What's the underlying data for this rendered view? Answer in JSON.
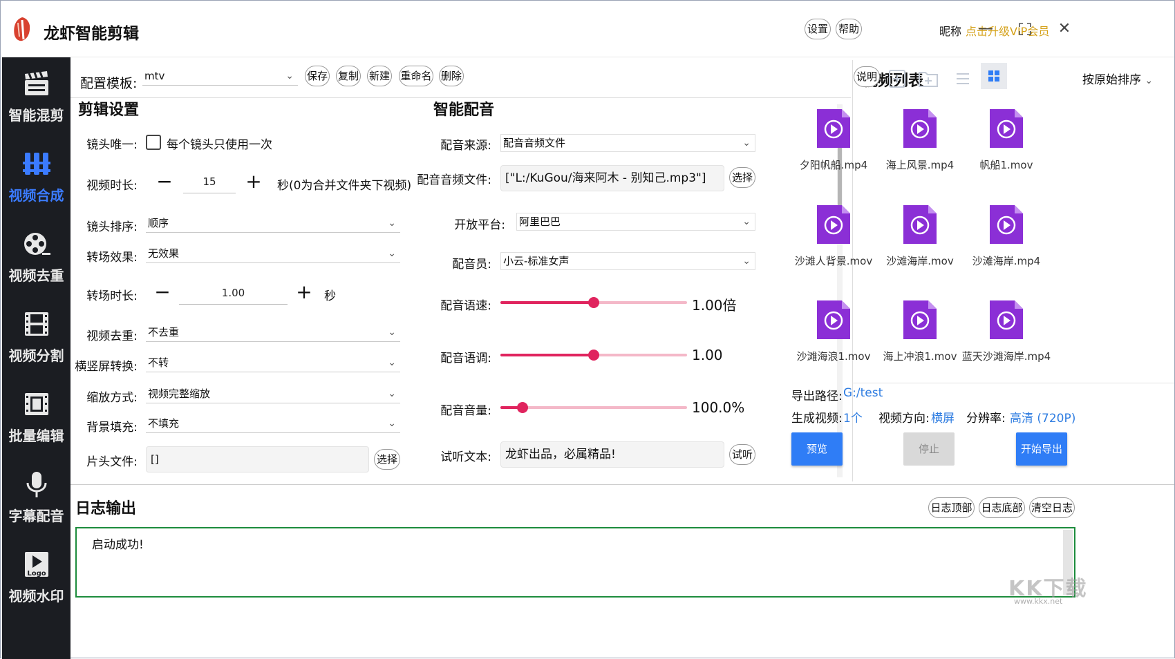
{
  "app": {
    "title": "龙虾智能剪辑"
  },
  "header": {
    "settings_label": "设置",
    "help_label": "帮助",
    "nickname_label": "昵称",
    "vip_label": "点击升级VIP会员",
    "minimize": "—",
    "maximize": "⛶",
    "close": "✕"
  },
  "sidebar": {
    "items": [
      {
        "label": "智能混剪",
        "icon": "clapperboard-icon"
      },
      {
        "label": "视频合成",
        "icon": "film-strips-icon",
        "active": true
      },
      {
        "label": "视频去重",
        "icon": "film-reel-icon"
      },
      {
        "label": "视频分割",
        "icon": "film-frame-icon"
      },
      {
        "label": "批量编辑",
        "icon": "film-edit-icon"
      },
      {
        "label": "字幕配音",
        "icon": "microphone-icon"
      },
      {
        "label": "视频水印",
        "icon": "logo-watermark-icon"
      }
    ]
  },
  "config": {
    "template_label": "配置模板:",
    "template_value": "mtv",
    "buttons": {
      "save": "保存",
      "copy": "复制",
      "new": "新建",
      "rename": "重命名",
      "delete": "删除"
    }
  },
  "edit_settings": {
    "title": "剪辑设置",
    "unique_label": "镜头唯一:",
    "unique_text": "每个镜头只使用一次",
    "duration_label": "视频时长:",
    "duration_value": "15",
    "duration_unit": "秒(0为合并文件夹下视频)",
    "order_label": "镜头排序:",
    "order_value": "顺序",
    "transition_label": "转场效果:",
    "transition_value": "无效果",
    "transition_duration_label": "转场时长:",
    "transition_duration_value": "1.00",
    "transition_duration_unit": "秒",
    "dedup_label": "视频去重:",
    "dedup_value": "不去重",
    "rotate_label": "横竖屏转换:",
    "rotate_value": "不转",
    "scale_label": "缩放方式:",
    "scale_value": "视频完整缩放",
    "bg_label": "背景填充:",
    "bg_value": "不填充",
    "intro_label": "片头文件:",
    "intro_value": "[]",
    "intro_select": "选择",
    "minus": "−",
    "plus": "+"
  },
  "dubbing": {
    "title": "智能配音",
    "source_label": "配音来源:",
    "source_value": "配音音频文件",
    "audio_label": "配音音频文件:",
    "audio_value": "[\"L:/KuGou/海来阿木 - 别知己.mp3\"]",
    "audio_select": "选择",
    "platform_label": "开放平台:",
    "platform_value": "阿里巴巴",
    "voice_label": "配音员:",
    "voice_value": "小云-标准女声",
    "speed_label": "配音语速:",
    "speed_value": "1.00倍",
    "speed_level": 0.5,
    "pitch_label": "配音语调:",
    "pitch_value": "1.00",
    "pitch_level": 0.5,
    "volume_label": "配音音量:",
    "volume_value": "100.0%",
    "volume_level": 0.12,
    "preview_text_label": "试听文本:",
    "preview_text_value": "龙虾出品，必属精品!",
    "preview_button": "试听"
  },
  "video_list": {
    "title": "视频列表",
    "help_label": "说明",
    "sort_label": "按原始排序",
    "files": [
      "夕阳帆船.mp4",
      "海上风景.mp4",
      "帆船1.mov",
      "沙滩人背景.mov",
      "沙滩海岸.mov",
      "沙滩海岸.mp4",
      "沙滩海浪1.mov",
      "海上冲浪1.mov",
      "蓝天沙滩海岸.mp4"
    ],
    "accent_color": "#8b2fd6"
  },
  "export": {
    "path_label": "导出路径:",
    "path_value": "G:/test",
    "count_label": "生成视频:",
    "count_value": "1个",
    "orientation_label": "视频方向:",
    "orientation_value": "横屏",
    "resolution_label": "分辨率:",
    "resolution_value": "高清 (720P)",
    "preview_button": "预览",
    "stop_button": "停止",
    "start_button": "开始导出"
  },
  "log": {
    "title": "日志输出",
    "top_button": "日志顶部",
    "bottom_button": "日志底部",
    "clear_button": "清空日志",
    "text": "启动成功!"
  },
  "watermark": {
    "main": "KK下载",
    "sub": "www.kkx.net"
  }
}
